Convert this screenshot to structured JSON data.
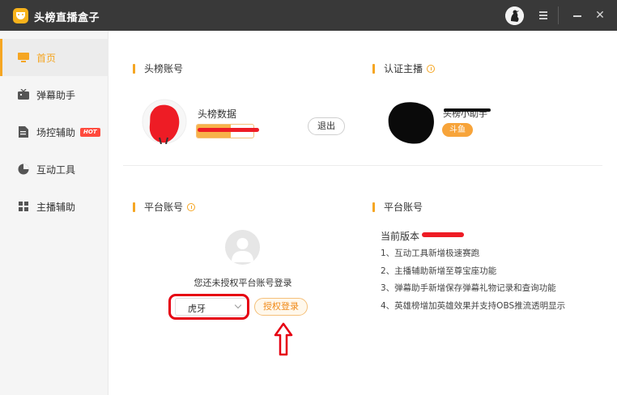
{
  "window": {
    "title": "头榜直播盒子",
    "close_glyph": "✕"
  },
  "sidebar": {
    "items": [
      {
        "label": "首页",
        "icon": "monitor-icon",
        "active": true
      },
      {
        "label": "弹幕助手",
        "icon": "tv-icon"
      },
      {
        "label": "场控辅助",
        "icon": "document-icon",
        "badge": "HOT"
      },
      {
        "label": "互动工具",
        "icon": "pie-chart-icon"
      },
      {
        "label": "主播辅助",
        "icon": "grid-icon"
      }
    ]
  },
  "toubang_account": {
    "title": "头榜账号",
    "data_label": "头榜数据",
    "level_fill": 0.6,
    "logout_label": "退出"
  },
  "certified_anchor": {
    "title": "认证主播",
    "name": "头榜小助手",
    "platform_tag": "斗鱼"
  },
  "platform_account": {
    "title": "平台账号",
    "empty_text": "您还未授权平台账号登录",
    "selected_platform": "虎牙",
    "auth_button": "授权登录"
  },
  "version_panel": {
    "title": "平台账号",
    "version_label": "当前版本",
    "changelog": [
      "1、互动工具新增极速赛跑",
      "2、主播辅助新增至尊宝座功能",
      "3、弹幕助手新增保存弹幕礼物记录和查询功能",
      "4、英雄榜增加英雄效果并支持OBS推流透明显示"
    ]
  },
  "colors": {
    "accent": "#f5a623",
    "titlebar": "#393939",
    "annotation_red": "#e60012"
  }
}
